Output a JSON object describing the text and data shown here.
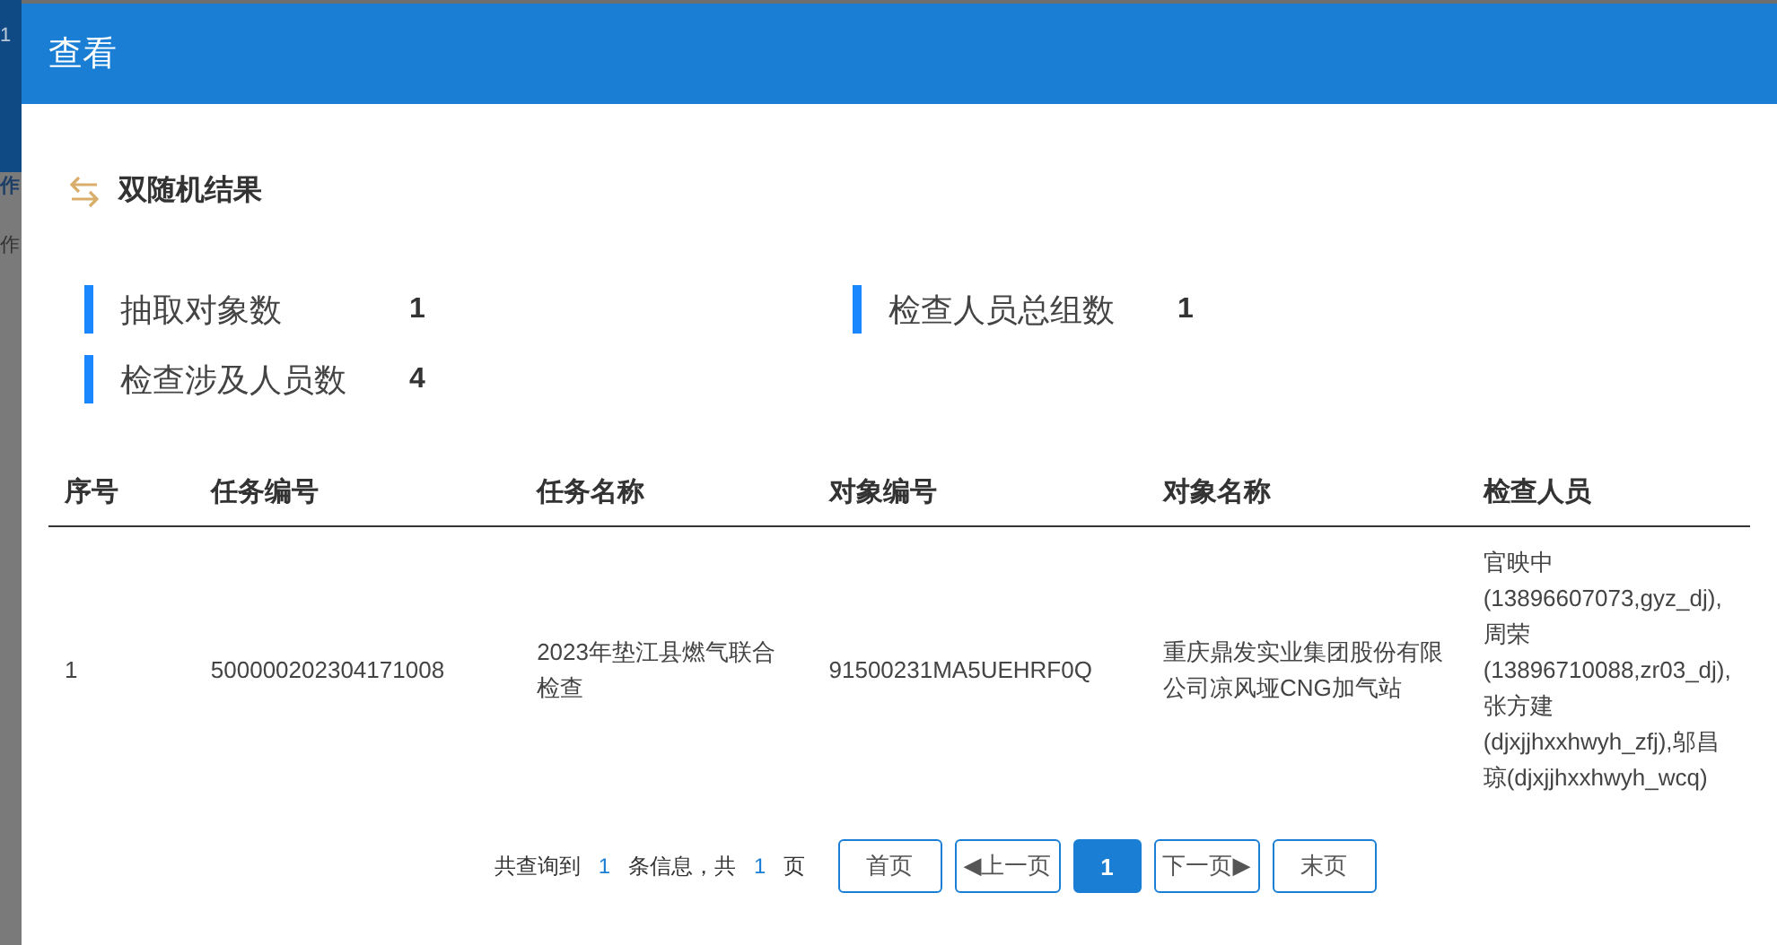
{
  "backdrop": {
    "texts": [
      "1",
      "作",
      "作"
    ]
  },
  "dialog": {
    "title": "查看"
  },
  "section": {
    "title": "双随机结果"
  },
  "stats": [
    {
      "label": "抽取对象数",
      "value": "1"
    },
    {
      "label": "检查人员总组数",
      "value": "1"
    },
    {
      "label": "检查涉及人员数",
      "value": "4"
    }
  ],
  "table": {
    "columns": [
      "序号",
      "任务编号",
      "任务名称",
      "对象编号",
      "对象名称",
      "检查人员"
    ],
    "rows": [
      [
        "1",
        "500000202304171008",
        "2023年垫江县燃气联合检查",
        "91500231MA5UEHRF0Q",
        "重庆鼎发实业集团股份有限公司凉风垭CNG加气站",
        "官映中(13896607073,gyz_dj),周荣(13896710088,zr03_dj),张方建(djxjjhxxhwyh_zfj),邬昌琼(djxjjhxxhwyh_wcq)"
      ]
    ]
  },
  "pagination": {
    "parts": [
      {
        "kind": "text",
        "text": "共查询到"
      },
      {
        "kind": "number",
        "text": "1"
      },
      {
        "kind": "text",
        "text": "条信息，共"
      },
      {
        "kind": "number",
        "text": "1"
      },
      {
        "kind": "text",
        "text": "页"
      }
    ],
    "buttons": [
      {
        "label": "首页",
        "selected": false
      },
      {
        "label": "◀上一页",
        "selected": false
      },
      {
        "label": "1",
        "selected": true
      },
      {
        "label": "下一页▶",
        "selected": false
      },
      {
        "label": "末页",
        "selected": false
      }
    ]
  }
}
